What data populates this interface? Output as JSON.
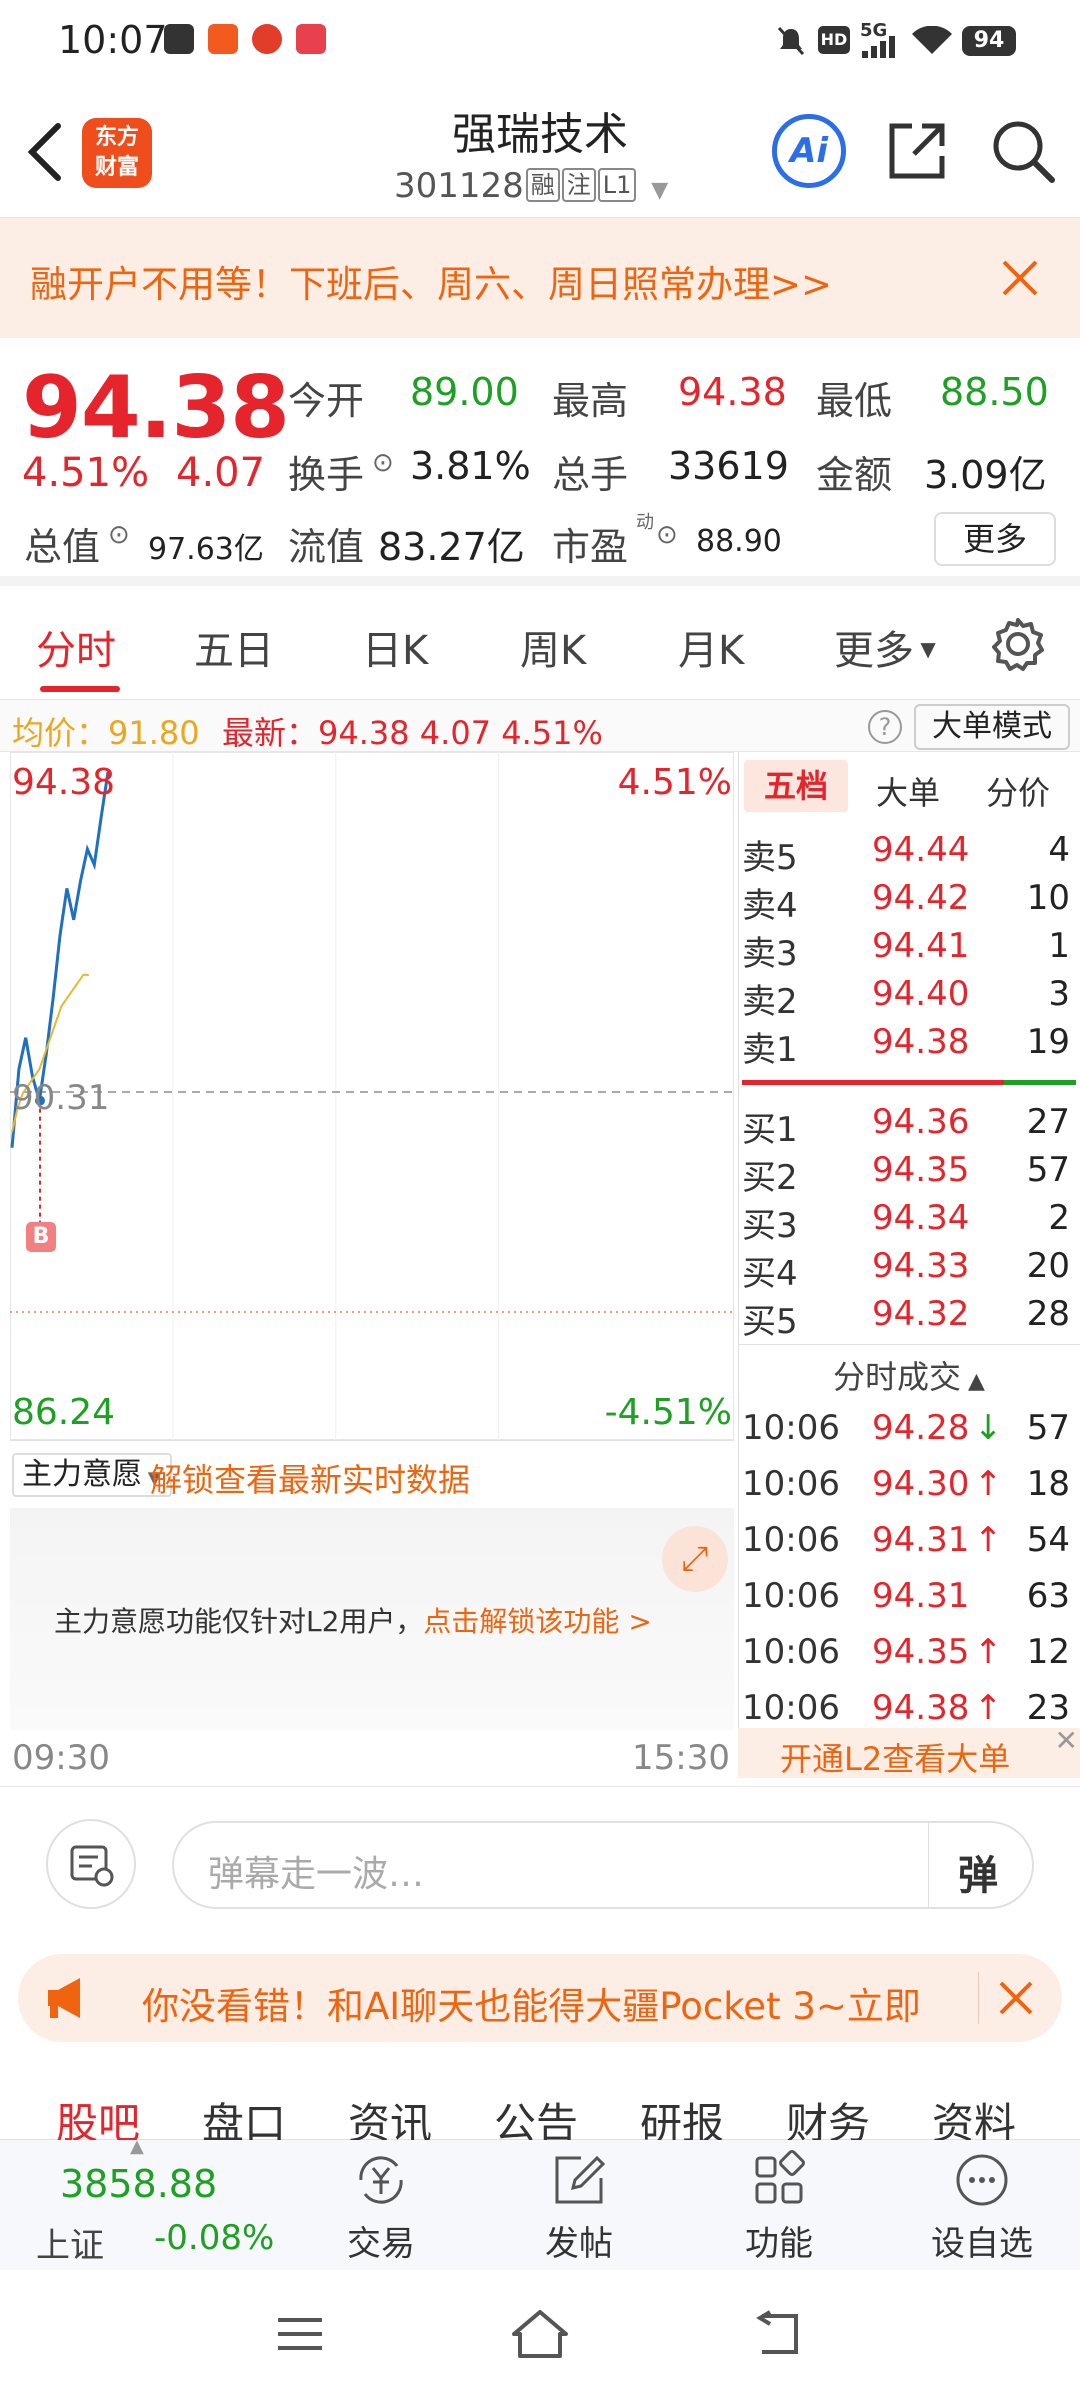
{
  "status_bar": {
    "time": "10:07",
    "network": "5G",
    "battery": "94"
  },
  "header": {
    "logo_text_line1": "东方",
    "logo_text_line2": "财富",
    "stock_name": "强瑞技术",
    "stock_code": "301128",
    "tags": [
      "融",
      "注",
      "L1"
    ],
    "ai_label": "Ai"
  },
  "banner": {
    "text": "融开户不用等！下班后、周六、周日照常办理>>"
  },
  "quote": {
    "price": "94.38",
    "change_pct": "4.51%",
    "change_amt": "4.07",
    "open_label": "今开",
    "open_value": "89.00",
    "high_label": "最高",
    "high_value": "94.38",
    "low_label": "最低",
    "low_value": "88.50",
    "turnover_label": "换手",
    "turnover_value": "3.81%",
    "volume_label": "总手",
    "volume_value": "33619",
    "amount_label": "金额",
    "amount_value": "3.09亿",
    "mktcap_label": "总值",
    "mktcap_value": "97.63亿",
    "float_label": "流值",
    "float_value": "83.27亿",
    "pe_label": "市盈",
    "pe_sup": "动",
    "pe_value": "88.90",
    "more_button": "更多"
  },
  "tabs": {
    "items": [
      "分时",
      "五日",
      "日K",
      "周K",
      "月K",
      "更多"
    ],
    "active": "分时"
  },
  "info_line": {
    "avg_label": "均价：",
    "avg_value": "91.80",
    "latest_label": "最新：",
    "latest_value": "94.38",
    "latest_change": "4.07",
    "latest_pct": "4.51%",
    "mode_button": "大单模式"
  },
  "chart": {
    "top_price": "94.38",
    "top_pct": "4.51%",
    "mid_price": "90.31",
    "bottom_price": "86.24",
    "bottom_pct": "-4.51%",
    "buy_marker": "B",
    "time_start": "09:30",
    "time_end": "15:30",
    "colors": {
      "price_line": "#1f6fc2",
      "avg_line": "#e8b830",
      "up": "#e5252b",
      "down": "#1ea024"
    }
  },
  "chart_data": {
    "type": "line",
    "series": [
      {
        "name": "最新",
        "values": [
          89.6,
          90.6,
          91.0,
          90.5,
          90.2,
          90.8,
          91.5,
          92.3,
          92.9,
          92.5,
          93.0,
          93.4,
          93.2,
          93.8,
          94.38
        ]
      },
      {
        "name": "均价",
        "values": [
          89.8,
          90.1,
          90.3,
          90.4,
          90.5,
          90.6,
          90.8,
          91.0,
          91.2,
          91.4,
          91.5,
          91.6,
          91.7,
          91.8,
          91.8
        ]
      }
    ],
    "ylim": [
      86.24,
      94.38
    ],
    "reference": 90.31,
    "xlabel": "",
    "ylabel": ""
  },
  "main_force": {
    "dropdown": "主力意愿",
    "unlock_text": "解锁查看最新实时数据",
    "notice_text": "主力意愿功能仅针对L2用户，",
    "notice_link": "点击解锁该功能 >"
  },
  "order_book": {
    "tabs": [
      "五档",
      "大单",
      "分价"
    ],
    "sells": [
      {
        "label": "卖5",
        "price": "94.44",
        "vol": "4"
      },
      {
        "label": "卖4",
        "price": "94.42",
        "vol": "10"
      },
      {
        "label": "卖3",
        "price": "94.41",
        "vol": "1"
      },
      {
        "label": "卖2",
        "price": "94.40",
        "vol": "3"
      },
      {
        "label": "卖1",
        "price": "94.38",
        "vol": "19"
      }
    ],
    "buys": [
      {
        "label": "买1",
        "price": "94.36",
        "vol": "27"
      },
      {
        "label": "买2",
        "price": "94.35",
        "vol": "57"
      },
      {
        "label": "买3",
        "price": "94.34",
        "vol": "2"
      },
      {
        "label": "买4",
        "price": "94.33",
        "vol": "20"
      },
      {
        "label": "买5",
        "price": "94.32",
        "vol": "28"
      }
    ],
    "ticks_title": "分时成交",
    "ticks": [
      {
        "time": "10:06",
        "price": "94.28",
        "arrow": "↓",
        "vol": "57"
      },
      {
        "time": "10:06",
        "price": "94.30",
        "arrow": "↑",
        "vol": "18"
      },
      {
        "time": "10:06",
        "price": "94.31",
        "arrow": "↑",
        "vol": "54"
      },
      {
        "time": "10:06",
        "price": "94.31",
        "arrow": "",
        "vol": "63"
      },
      {
        "time": "10:06",
        "price": "94.35",
        "arrow": "↑",
        "vol": "12"
      },
      {
        "time": "10:06",
        "price": "94.38",
        "arrow": "↑",
        "vol": "23"
      }
    ],
    "l2_button": "开通L2查看大单"
  },
  "comment": {
    "placeholder": "弹幕走一波…",
    "send_label": "弹"
  },
  "promo": {
    "text": "你没看错！和AI聊天也能得大疆Pocket 3~立即"
  },
  "bottom_tabs": {
    "items": [
      "股吧",
      "盘口",
      "资讯",
      "公告",
      "研报",
      "财务",
      "资料"
    ],
    "active": "股吧"
  },
  "bottom_bar": {
    "index_value": "3858.88",
    "index_name": "上证",
    "index_change": "-0.08%",
    "actions": [
      "交易",
      "发帖",
      "功能",
      "设自选"
    ]
  }
}
